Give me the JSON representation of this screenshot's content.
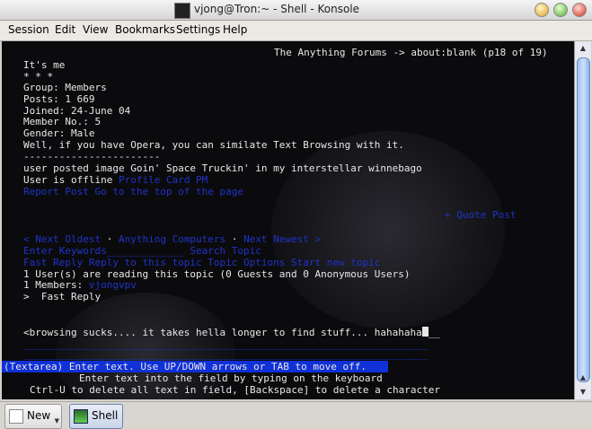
{
  "window": {
    "title": "vjong@Tron:~ - Shell - Konsole"
  },
  "menu": [
    "Session",
    "Edit",
    "View",
    "Bookmarks",
    "Settings",
    "Help"
  ],
  "terminal": {
    "header": "The Anything Forums -> about:blank (p18 of 19)",
    "post_lines": [
      "It's me",
      "* * *",
      "Group: Members",
      "Posts: 1 669",
      "Joined: 24-June 04",
      "Member No.: 5",
      "Gender: Male",
      "Well, if you have Opera, you can similate Text Browsing with it.",
      "-----------------------",
      "user posted image Goin' Space Truckin' in my interstellar winnebago"
    ],
    "offline_prefix": "User is offline",
    "offline_link": "Profile Card PM",
    "report_link": "Report Post Go to the top of the page",
    "quote_link": "+ Quote Post",
    "nav_oldest": "< Next Oldest",
    "nav_forum": "Anything Computers",
    "nav_newest": "Next Newest >",
    "nav_sep": "·",
    "keywords_line": "Enter Keywords_____________ Search Topic",
    "fastreply_line": "Fast Reply Reply to this topic Topic Options Start new topic",
    "readers_line": "1 User(s) are reading this topic (0 Guests and 0 Anonymous Users)",
    "members_prefix": "1 Members:",
    "members_link": "vjongvpv",
    "fast_reply": ">  Fast Reply",
    "textarea_text": "<browsing sucks.... it takes hella longer to find stuff... hahahaha",
    "textarea_tail": "__",
    "divider_line": "____________________________________________________________________",
    "status_line": "(Textarea) Enter text. Use UP/DOWN arrows or TAB to move off.",
    "help_line_1": "Enter text into the field by typing on the keyboard",
    "help_line_2": "Ctrl-U to delete all text in field, [Backspace] to delete a character"
  },
  "taskbar": {
    "tabs": [
      {
        "label": "New"
      },
      {
        "label": "Shell"
      }
    ]
  },
  "colors": {
    "terminal_bg": "#0b0b0d",
    "link": "#1f33c8",
    "status_bg": "#1030d8"
  }
}
